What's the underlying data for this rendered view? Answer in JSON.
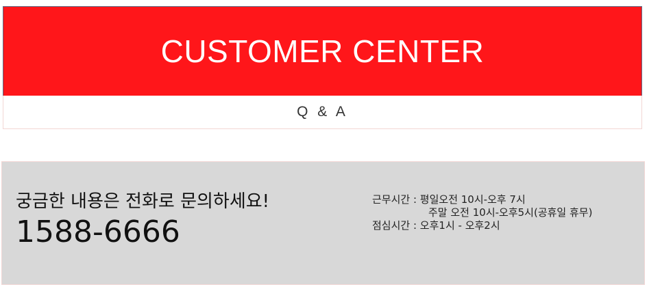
{
  "header": {
    "title": "CUSTOMER CENTER"
  },
  "tabs": [
    {
      "label": "Q & A"
    }
  ],
  "contact": {
    "headline": "궁금한 내용은 전화로 문의하세요!",
    "phone": "1588-6666"
  },
  "hours": {
    "work_label": "근무시간 :",
    "weekday": " 평일오전 10시-오후 7시",
    "weekend": "주말 오전 10시-오후5시(공휴일 휴무)",
    "lunch_label": "점심시간 :",
    "lunch": " 오후1시 - 오후2시"
  },
  "colors": {
    "banner": "#ff161a",
    "info_background": "#d8d8d8"
  }
}
